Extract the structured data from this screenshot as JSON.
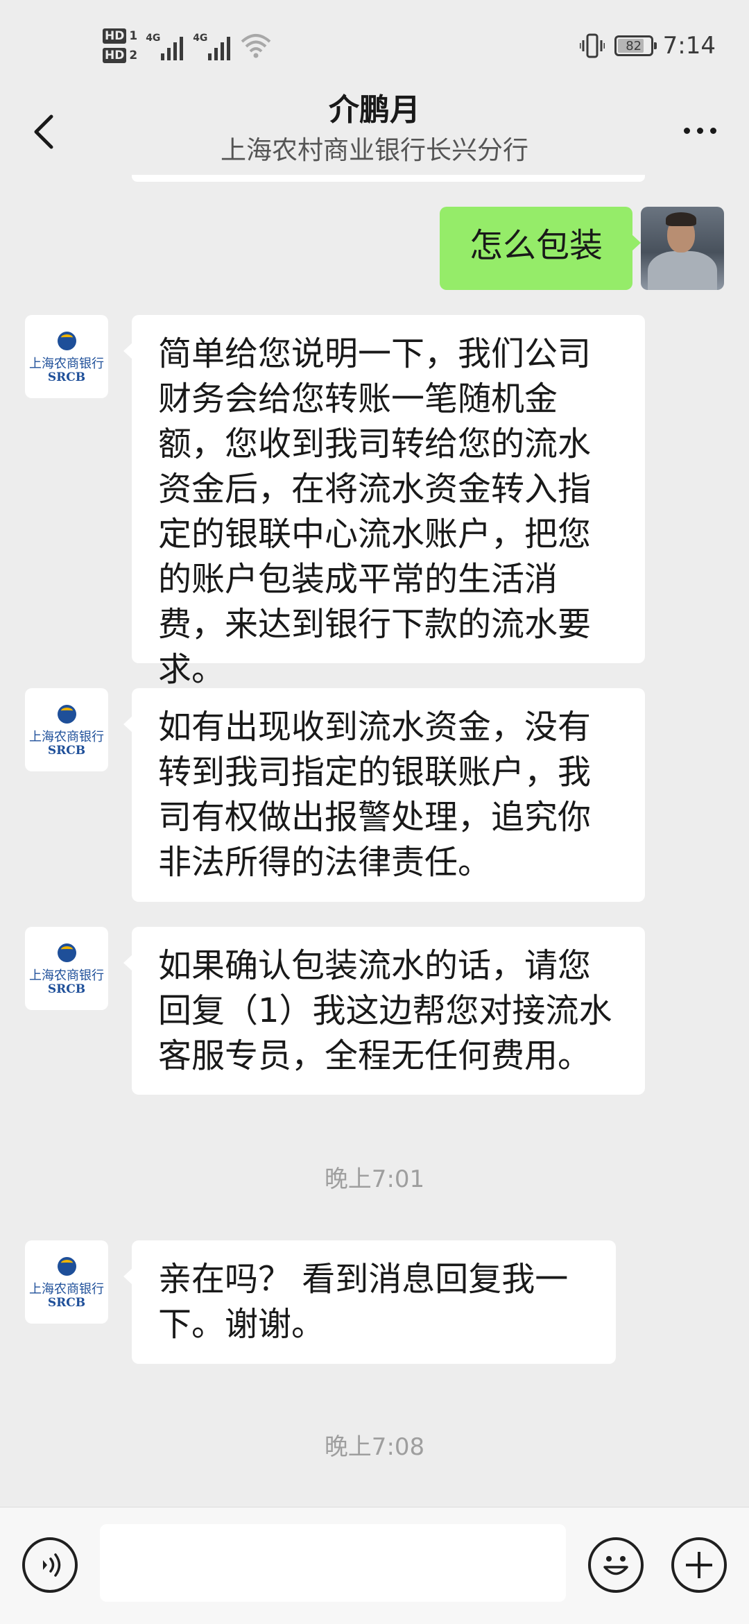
{
  "status_bar": {
    "sim1_badge": "HD",
    "sim1_num": "1",
    "sim2_badge": "HD",
    "sim2_num": "2",
    "network1": "4G",
    "network2": "4G",
    "battery": "82",
    "battery_level_percent": 82,
    "time": "7:14",
    "icons": [
      "signal-icon",
      "wifi-icon",
      "vibrate-icon",
      "battery-icon"
    ]
  },
  "header": {
    "title": "介鹏月",
    "subtitle": "上海农村商业银行长兴分行",
    "icons": [
      "back-icon",
      "more-icon"
    ]
  },
  "bank_avatar": {
    "name_cn": "上海农商银行",
    "name_en": "SRCB"
  },
  "messages": [
    {
      "from": "me",
      "text": "怎么包装"
    },
    {
      "from": "contact",
      "text": "简单给您说明一下，我们公司财务会给您转账一笔随机金额，您收到我司转给您的流水资金后，在将流水资金转入指定的银联中心流水账户，把您的账户包装成平常的生活消费，来达到银行下款的流水要求。"
    },
    {
      "from": "contact",
      "text": "如有出现收到流水资金，没有转到我司指定的银联账户，我司有权做出报警处理，追究你非法所得的法律责任。"
    },
    {
      "from": "contact",
      "text": "如果确认包装流水的话，请您回复（1）我这边帮您对接流水客服专员，全程无任何费用。"
    },
    {
      "from": "contact",
      "text": "亲在吗？ 看到消息回复我一下。谢谢。"
    }
  ],
  "timestamps": [
    "晚上7:01",
    "晚上7:08"
  ],
  "input_bar": {
    "placeholder": "",
    "icons": [
      "voice-icon",
      "emoji-icon",
      "plus-icon"
    ]
  },
  "colors": {
    "background": "#ededed",
    "my_bubble": "#95ec69",
    "contact_bubble": "#ffffff",
    "bank_blue": "#1e4f99",
    "bank_gold": "#f0b400"
  }
}
